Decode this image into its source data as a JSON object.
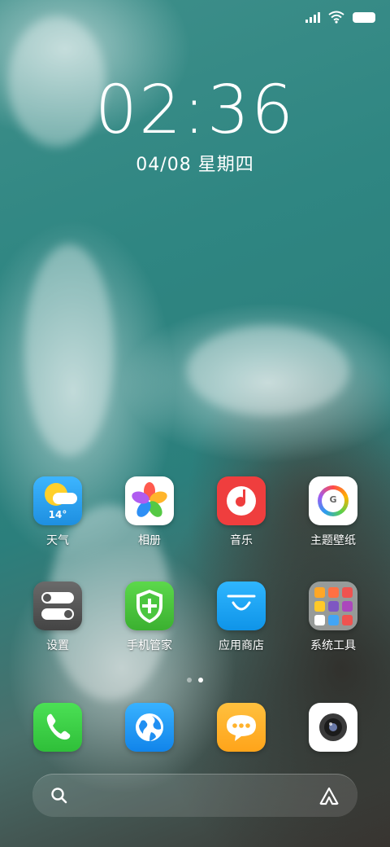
{
  "status_bar": {
    "signal_icon": "signal-icon",
    "wifi_icon": "wifi-icon",
    "battery_icon": "battery-icon"
  },
  "lock": {
    "time": "02:36",
    "date": "04/08 星期四"
  },
  "apps": [
    {
      "label": "天气",
      "icon": "weather-icon",
      "temp": "14°"
    },
    {
      "label": "相册",
      "icon": "gallery-icon"
    },
    {
      "label": "音乐",
      "icon": "music-icon"
    },
    {
      "label": "主题壁纸",
      "icon": "themes-icon"
    },
    {
      "label": "设置",
      "icon": "settings-icon"
    },
    {
      "label": "手机管家",
      "icon": "security-icon"
    },
    {
      "label": "应用商店",
      "icon": "app-store-icon"
    },
    {
      "label": "系统工具",
      "icon": "system-tools-folder-icon"
    }
  ],
  "page_indicator": {
    "pages": 2,
    "active": 1
  },
  "dock": [
    {
      "icon": "phone-icon"
    },
    {
      "icon": "browser-icon"
    },
    {
      "icon": "messages-icon"
    },
    {
      "icon": "camera-icon"
    }
  ],
  "search_bar": {
    "search_icon": "search-icon",
    "assistant_icon": "assistant-icon"
  },
  "colors": {
    "weather": "#2ea8f2",
    "music": "#ef3e3e",
    "settings": "#555555",
    "security": "#4bc63f",
    "app_store": "#19a6f2",
    "phone": "#3fd14a",
    "browser": "#1f8ff2",
    "messages": "#ffb22c"
  }
}
